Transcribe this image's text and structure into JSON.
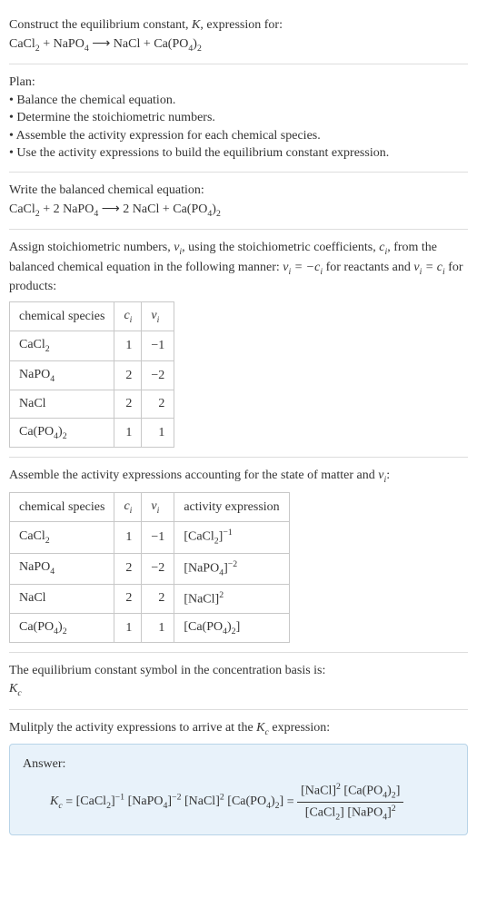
{
  "prompt": {
    "line1_pre": "Construct the equilibrium constant, ",
    "line1_mid": ", expression for:",
    "eq": "CaCl₂ + NaPO₄ ⟶ NaCl + Ca(PO₄)₂"
  },
  "plan": {
    "title": "Plan:",
    "items": [
      "• Balance the chemical equation.",
      "• Determine the stoichiometric numbers.",
      "• Assemble the activity expression for each chemical species.",
      "• Use the activity expressions to build the equilibrium constant expression."
    ]
  },
  "balanced": {
    "title": "Write the balanced chemical equation:",
    "eq": "CaCl₂ + 2 NaPO₄ ⟶ 2 NaCl + Ca(PO₄)₂"
  },
  "stoich": {
    "text_pre": "Assign stoichiometric numbers, ",
    "text_mid1": ", using the stoichiometric coefficients, ",
    "text_mid2": ", from the balanced chemical equation in the following manner: ",
    "text_mid3": " for reactants and ",
    "text_end": " for products:",
    "headers": {
      "h1": "chemical species"
    },
    "rows": [
      {
        "sp": "CaCl₂",
        "c": "1",
        "v": "−1"
      },
      {
        "sp": "NaPO₄",
        "c": "2",
        "v": "−2"
      },
      {
        "sp": "NaCl",
        "c": "2",
        "v": "2"
      },
      {
        "sp": "Ca(PO₄)₂",
        "c": "1",
        "v": "1"
      }
    ]
  },
  "activity": {
    "title_pre": "Assemble the activity expressions accounting for the state of matter and ",
    "title_post": ":",
    "headers": {
      "h1": "chemical species",
      "h4": "activity expression"
    },
    "rows": [
      {
        "sp": "CaCl₂",
        "c": "1",
        "v": "−1",
        "ae_base": "[CaCl₂]",
        "ae_exp": "−1"
      },
      {
        "sp": "NaPO₄",
        "c": "2",
        "v": "−2",
        "ae_base": "[NaPO₄]",
        "ae_exp": "−2"
      },
      {
        "sp": "NaCl",
        "c": "2",
        "v": "2",
        "ae_base": "[NaCl]",
        "ae_exp": "2"
      },
      {
        "sp": "Ca(PO₄)₂",
        "c": "1",
        "v": "1",
        "ae_base": "[Ca(PO₄)₂]",
        "ae_exp": ""
      }
    ]
  },
  "symbol": {
    "title": "The equilibrium constant symbol in the concentration basis is:"
  },
  "multiply": {
    "title_pre": "Mulitply the activity expressions to arrive at the ",
    "title_post": " expression:"
  },
  "answer": {
    "label": "Answer:",
    "lhs_k": "K",
    "lhs_sub": "c",
    "eq": " = ",
    "t1_base": "[CaCl₂]",
    "t1_exp": "−1",
    "t2_base": "[NaPO₄]",
    "t2_exp": "−2",
    "t3_base": "[NaCl]",
    "t3_exp": "2",
    "t4_base": "[Ca(PO₄)₂]",
    "eq2": " = ",
    "num1_base": "[NaCl]",
    "num1_exp": "2",
    "num2_base": "[Ca(PO₄)₂]",
    "den1_base": "[CaCl₂]",
    "den2_base": "[NaPO₄]",
    "den2_exp": "2"
  }
}
